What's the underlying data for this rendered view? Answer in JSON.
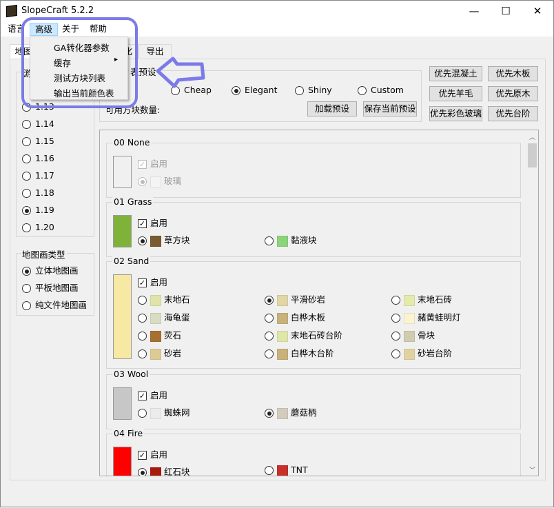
{
  "window": {
    "title": "SlopeCraft 5.2.2",
    "minimize": "—",
    "maximize": "☐",
    "close": "✕"
  },
  "menubar": [
    {
      "label": "语言"
    },
    {
      "label": "高级"
    },
    {
      "label": "关于"
    },
    {
      "label": "帮助"
    }
  ],
  "dropdown": [
    {
      "label": "GA转化器参数"
    },
    {
      "label": "缓存",
      "submenu": "▸"
    },
    {
      "label": "测试方块列表"
    },
    {
      "label": "输出当前颜色表"
    }
  ],
  "tabs": [
    {
      "label": "地图"
    },
    {
      "label": "化"
    },
    {
      "label": "导出"
    }
  ],
  "version_group": {
    "title": "游",
    "options": [
      {
        "label": "1.13",
        "checked": false
      },
      {
        "label": "1.14",
        "checked": false
      },
      {
        "label": "1.15",
        "checked": false
      },
      {
        "label": "1.16",
        "checked": false
      },
      {
        "label": "1.17",
        "checked": false
      },
      {
        "label": "1.18",
        "checked": false
      },
      {
        "label": "1.19",
        "checked": true
      },
      {
        "label": "1.20",
        "checked": false
      }
    ]
  },
  "map_type_group": {
    "title": "地图画类型",
    "options": [
      {
        "label": "立体地图画",
        "checked": true
      },
      {
        "label": "平板地图画",
        "checked": false
      },
      {
        "label": "纯文件地图画",
        "checked": false
      }
    ]
  },
  "preset": {
    "title": "表预设",
    "options": [
      {
        "label": "nilla",
        "checked": false
      },
      {
        "label": "Cheap",
        "checked": false
      },
      {
        "label": "Elegant",
        "checked": true
      },
      {
        "label": "Shiny",
        "checked": false
      },
      {
        "label": "Custom",
        "checked": false
      }
    ],
    "count_label": "可用方块数量:",
    "load": "加载预设",
    "save": "保存当前预设"
  },
  "priority_buttons": [
    "优先混凝土",
    "优先木板",
    "优先羊毛",
    "优先原木",
    "优先彩色玻璃",
    "优先台阶"
  ],
  "enable_label": "启用",
  "blocks": [
    {
      "title": "00 None",
      "color": "#f0f0f0",
      "enabled": true,
      "disabled": true,
      "options": [
        {
          "label": "玻璃",
          "tex": "#f4f4f4",
          "checked": true
        }
      ]
    },
    {
      "title": "01 Grass",
      "color": "#7fb238",
      "enabled": true,
      "options": [
        {
          "label": "草方块",
          "tex": "#7a5a30",
          "checked": true
        },
        {
          "label": "黏液块",
          "tex": "#8cd47a",
          "checked": false
        }
      ]
    },
    {
      "title": "02 Sand",
      "color": "#f7e9a3",
      "enabled": true,
      "options": [
        {
          "label": "末地石",
          "tex": "#e0e4a8",
          "checked": false
        },
        {
          "label": "平滑砂岩",
          "tex": "#e2d6a4",
          "checked": true
        },
        {
          "label": "末地石砖",
          "tex": "#e4eaaa",
          "checked": false
        },
        {
          "label": "海龟蛋",
          "tex": "#d8dcc0",
          "checked": false
        },
        {
          "label": "白桦木板",
          "tex": "#c8b27a",
          "checked": false
        },
        {
          "label": "赭黄蛙明灯",
          "tex": "#fbf4d0",
          "checked": false
        },
        {
          "label": "荧石",
          "tex": "#a8702e",
          "checked": false
        },
        {
          "label": "末地石砖台阶",
          "tex": "#dfe6a8",
          "checked": false
        },
        {
          "label": "骨块",
          "tex": "#d0ccb0",
          "checked": false
        },
        {
          "label": "砂岩",
          "tex": "#dccb95",
          "checked": false
        },
        {
          "label": "白桦木台阶",
          "tex": "#c8b27a",
          "checked": false
        },
        {
          "label": "砂岩台阶",
          "tex": "#e0d3a0",
          "checked": false
        }
      ]
    },
    {
      "title": "03 Wool",
      "color": "#c7c7c7",
      "enabled": true,
      "options": [
        {
          "label": "蜘蛛网",
          "tex": "#ececec",
          "checked": false
        },
        {
          "label": "蘑菇柄",
          "tex": "#d4cbbf",
          "checked": true
        }
      ]
    },
    {
      "title": "04 Fire",
      "color": "#ff0000",
      "enabled": true,
      "options": [
        {
          "label": "红石块",
          "tex": "#a81a0c",
          "checked": true
        },
        {
          "label": "TNT",
          "tex": "#c8302a",
          "checked": false
        }
      ]
    }
  ],
  "highlight_color": "#7b7be8"
}
